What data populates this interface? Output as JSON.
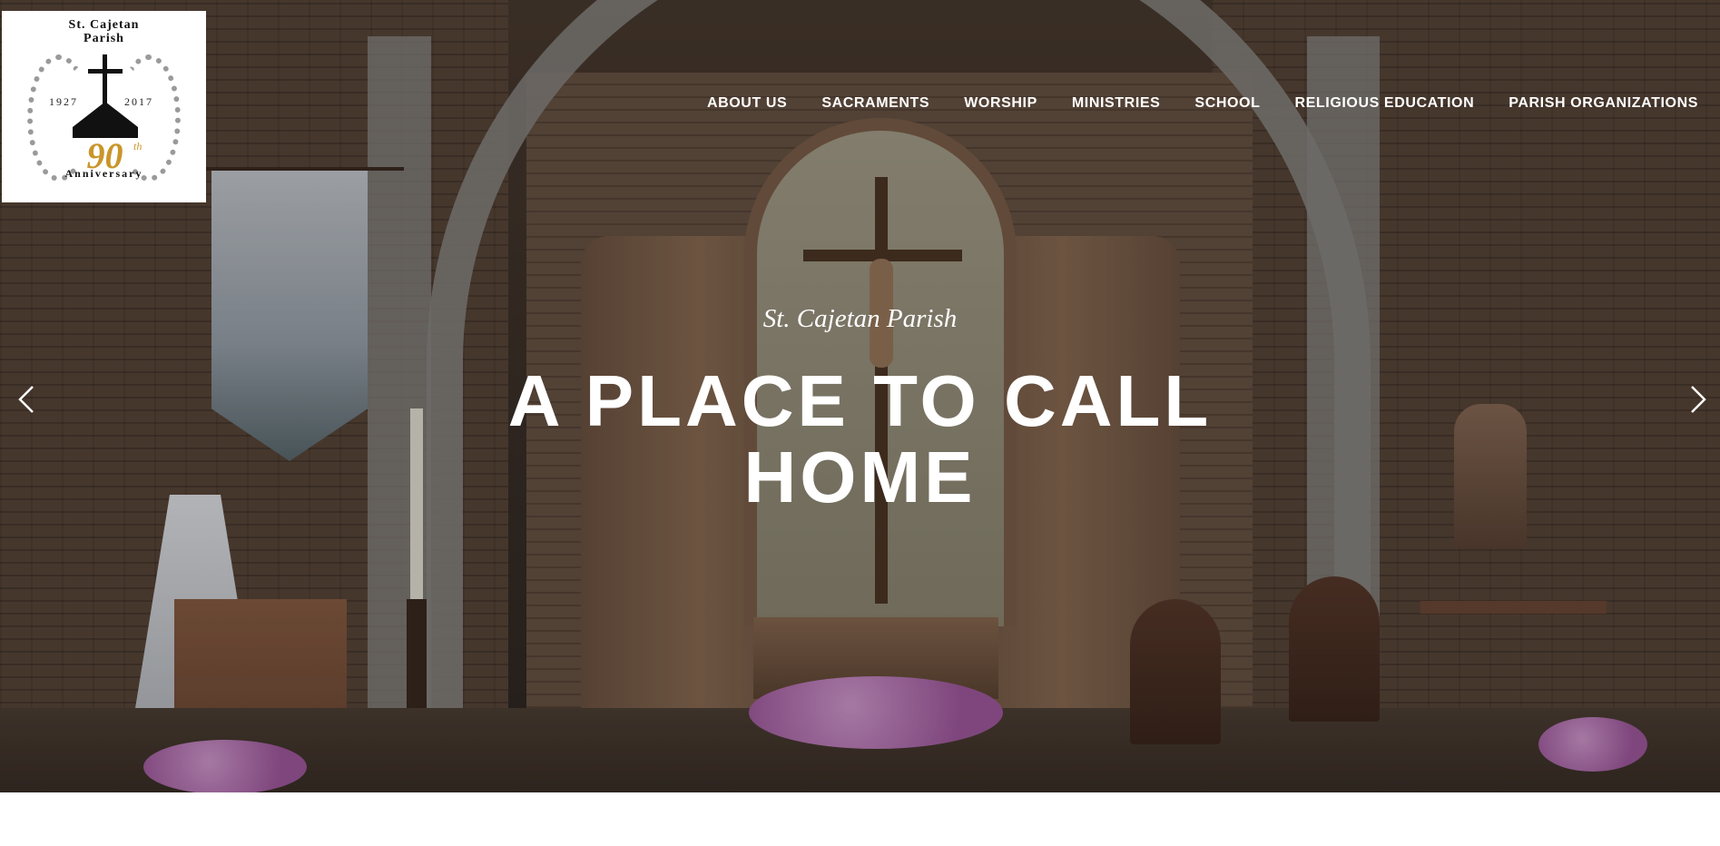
{
  "logo": {
    "name": "St. Cajetan\nParish",
    "year_start": "1927",
    "year_end": "2017",
    "anniversary_number": "90",
    "anniversary_suffix": "th",
    "anniversary_label": "Anniversary",
    "accent_color": "#c9962a"
  },
  "nav": {
    "items": [
      {
        "label": "ABOUT US"
      },
      {
        "label": "SACRAMENTS"
      },
      {
        "label": "WORSHIP"
      },
      {
        "label": "MINISTRIES"
      },
      {
        "label": "SCHOOL"
      },
      {
        "label": "RELIGIOUS EDUCATION"
      },
      {
        "label": "PARISH ORGANIZATIONS"
      }
    ]
  },
  "hero": {
    "tagline": "St. Cajetan Parish",
    "headline": "A PLACE TO CALL HOME",
    "prev_icon": "chevron-left-icon",
    "next_icon": "chevron-right-icon"
  }
}
